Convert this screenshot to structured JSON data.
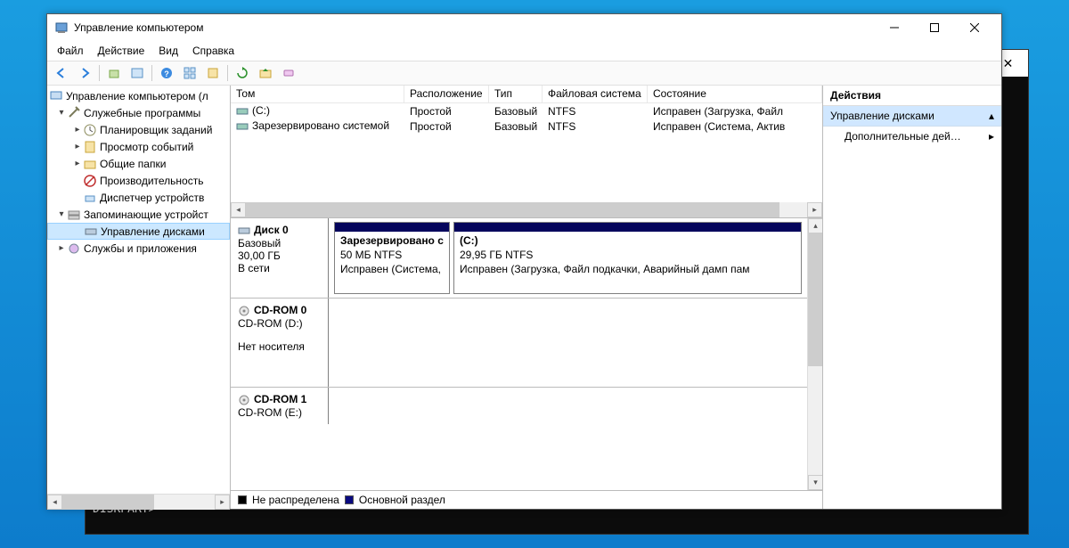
{
  "background_cmd": {
    "prompt": "DISKPART>"
  },
  "window": {
    "title": "Управление компьютером"
  },
  "menubar": {
    "file": "Файл",
    "action": "Действие",
    "view": "Вид",
    "help": "Справка"
  },
  "tree": {
    "root": "Управление компьютером (л",
    "service_tools": "Служебные программы",
    "task_scheduler": "Планировщик заданий",
    "event_viewer": "Просмотр событий",
    "shared_folders": "Общие папки",
    "performance": "Производительность",
    "device_manager": "Диспетчер устройств",
    "storage": "Запоминающие устройст",
    "disk_mgmt": "Управление дисками",
    "services_apps": "Службы и приложения"
  },
  "vol_columns": {
    "vol": "Том",
    "layout": "Расположение",
    "type": "Тип",
    "fs": "Файловая система",
    "status": "Состояние"
  },
  "volumes": [
    {
      "name": "(C:)",
      "layout": "Простой",
      "type": "Базовый",
      "fs": "NTFS",
      "status": "Исправен (Загрузка, Файл"
    },
    {
      "name": "Зарезервировано системой",
      "layout": "Простой",
      "type": "Базовый",
      "fs": "NTFS",
      "status": "Исправен (Система, Актив"
    }
  ],
  "disks": {
    "d0": {
      "name": "Диск 0",
      "type": "Базовый",
      "size": "30,00 ГБ",
      "state": "В сети",
      "p0": {
        "name": "Зарезервировано с",
        "size": "50 МБ NTFS",
        "status": "Исправен (Система,"
      },
      "p1": {
        "name": "(C:)",
        "size": "29,95 ГБ NTFS",
        "status": "Исправен (Загрузка, Файл подкачки, Аварийный дамп пам"
      }
    },
    "cd0": {
      "name": "CD-ROM 0",
      "drive": "CD-ROM (D:)",
      "state": "Нет носителя"
    },
    "cd1": {
      "name": "CD-ROM 1",
      "drive": "CD-ROM (E:)"
    }
  },
  "legend": {
    "unallocated": "Не распределена",
    "primary": "Основной раздел"
  },
  "actions": {
    "header": "Действия",
    "selected": "Управление дисками",
    "more": "Дополнительные дей…"
  },
  "col_widths": {
    "vol": "195px",
    "layout": "95px",
    "type": "60px",
    "fs": "118px",
    "status": "200px"
  }
}
